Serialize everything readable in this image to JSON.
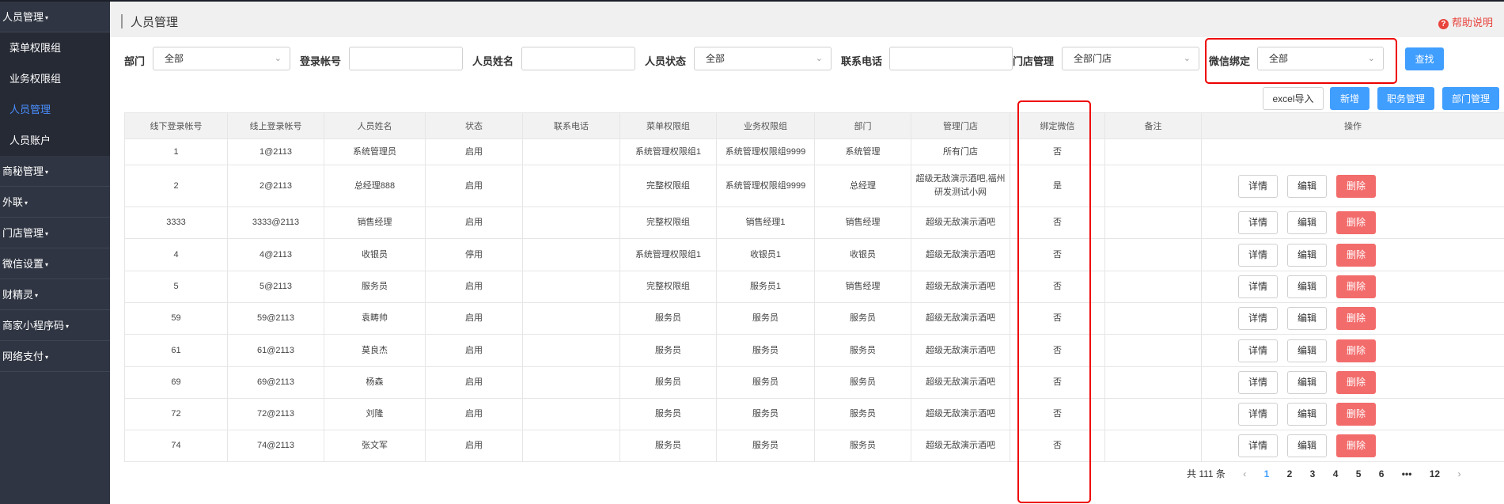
{
  "sidebar": {
    "groups": [
      {
        "label": "人员管理"
      },
      {
        "label": "商秘管理"
      },
      {
        "label": "外联"
      },
      {
        "label": "门店管理"
      },
      {
        "label": "微信设置"
      },
      {
        "label": "财精灵"
      },
      {
        "label": "商家小程序码"
      },
      {
        "label": "网络支付"
      }
    ],
    "sub_items": [
      {
        "label": "菜单权限组"
      },
      {
        "label": "业务权限组"
      },
      {
        "label": "人员管理"
      },
      {
        "label": "人员账户"
      }
    ],
    "caret": "▾"
  },
  "header": {
    "title": "人员管理",
    "help": "帮助说明",
    "help_icon": "?"
  },
  "filters": {
    "dept_label": "部门",
    "dept_value": "全部",
    "login_label": "登录帐号",
    "login_value": "",
    "name_label": "人员姓名",
    "name_value": "",
    "status_label": "人员状态",
    "status_value": "全部",
    "phone_label": "联系电话",
    "phone_value": "",
    "store_label": "门店管理",
    "store_value": "全部门店",
    "wechat_label": "微信绑定",
    "wechat_value": "全部",
    "search_button": "查找",
    "chevron": "⌄"
  },
  "actions": {
    "excel_import": "excel导入",
    "add": "新增",
    "job_manage": "职务管理",
    "dept_manage": "部门管理"
  },
  "table": {
    "headers": [
      "线下登录帐号",
      "线上登录帐号",
      "人员姓名",
      "状态",
      "联系电话",
      "菜单权限组",
      "业务权限组",
      "部门",
      "管理门店",
      "绑定微信",
      "备注",
      "操作"
    ],
    "rows": [
      [
        "1",
        "1@2113",
        "系统管理员",
        "启用",
        "",
        "系统管理权限组1",
        "系统管理权限组9999",
        "系统管理",
        "所有门店",
        "否",
        ""
      ],
      [
        "2",
        "2@2113",
        "总经理888",
        "启用",
        "",
        "完整权限组",
        "系统管理权限组9999",
        "总经理",
        "超级无敌演示酒吧,福州研发测试小网",
        "是",
        ""
      ],
      [
        "3333",
        "3333@2113",
        "销售经理",
        "启用",
        "",
        "完整权限组",
        "销售经理1",
        "销售经理",
        "超级无敌演示酒吧",
        "否",
        ""
      ],
      [
        "4",
        "4@2113",
        "收银员",
        "停用",
        "",
        "系统管理权限组1",
        "收银员1",
        "收银员",
        "超级无敌演示酒吧",
        "否",
        ""
      ],
      [
        "5",
        "5@2113",
        "服务员",
        "启用",
        "",
        "完整权限组",
        "服务员1",
        "销售经理",
        "超级无敌演示酒吧",
        "否",
        ""
      ],
      [
        "59",
        "59@2113",
        "袁畴帅",
        "启用",
        "",
        "服务员",
        "服务员",
        "服务员",
        "超级无敌演示酒吧",
        "否",
        ""
      ],
      [
        "61",
        "61@2113",
        "莫良杰",
        "启用",
        "",
        "服务员",
        "服务员",
        "服务员",
        "超级无敌演示酒吧",
        "否",
        ""
      ],
      [
        "69",
        "69@2113",
        "杨森",
        "启用",
        "",
        "服务员",
        "服务员",
        "服务员",
        "超级无敌演示酒吧",
        "否",
        ""
      ],
      [
        "72",
        "72@2113",
        "刘隆",
        "启用",
        "",
        "服务员",
        "服务员",
        "服务员",
        "超级无敌演示酒吧",
        "否",
        ""
      ],
      [
        "74",
        "74@2113",
        "张文军",
        "启用",
        "",
        "服务员",
        "服务员",
        "服务员",
        "超级无敌演示酒吧",
        "否",
        ""
      ]
    ],
    "row_actions": {
      "detail": "详情",
      "edit": "编辑",
      "delete": "删除"
    }
  },
  "pagination": {
    "total": "共 111 条",
    "prev": "‹",
    "pages": [
      "1",
      "2",
      "3",
      "4",
      "5",
      "6"
    ],
    "ellipsis": "•••",
    "last": "12",
    "next": "›",
    "current": "1"
  },
  "colors": {
    "sidebar_bg": "#2f3542",
    "primary": "#409eff",
    "danger": "#f36c6c",
    "highlight_box": "#ee0000"
  }
}
